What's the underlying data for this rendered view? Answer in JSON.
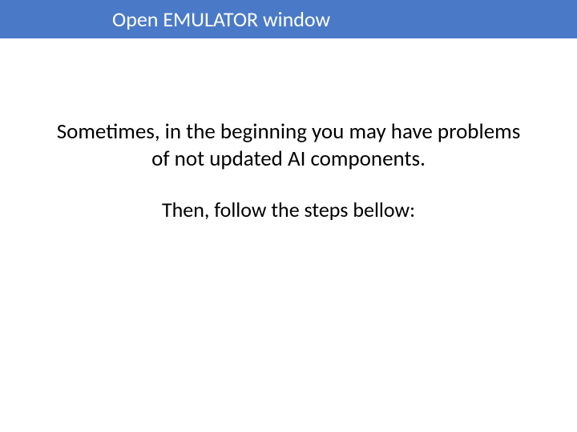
{
  "title_bar": {
    "text": "Open EMULATOR window"
  },
  "body": {
    "paragraph1": "Sometimes, in the beginning you may have problems of not updated AI components.",
    "paragraph2": "Then, follow the steps bellow:"
  }
}
